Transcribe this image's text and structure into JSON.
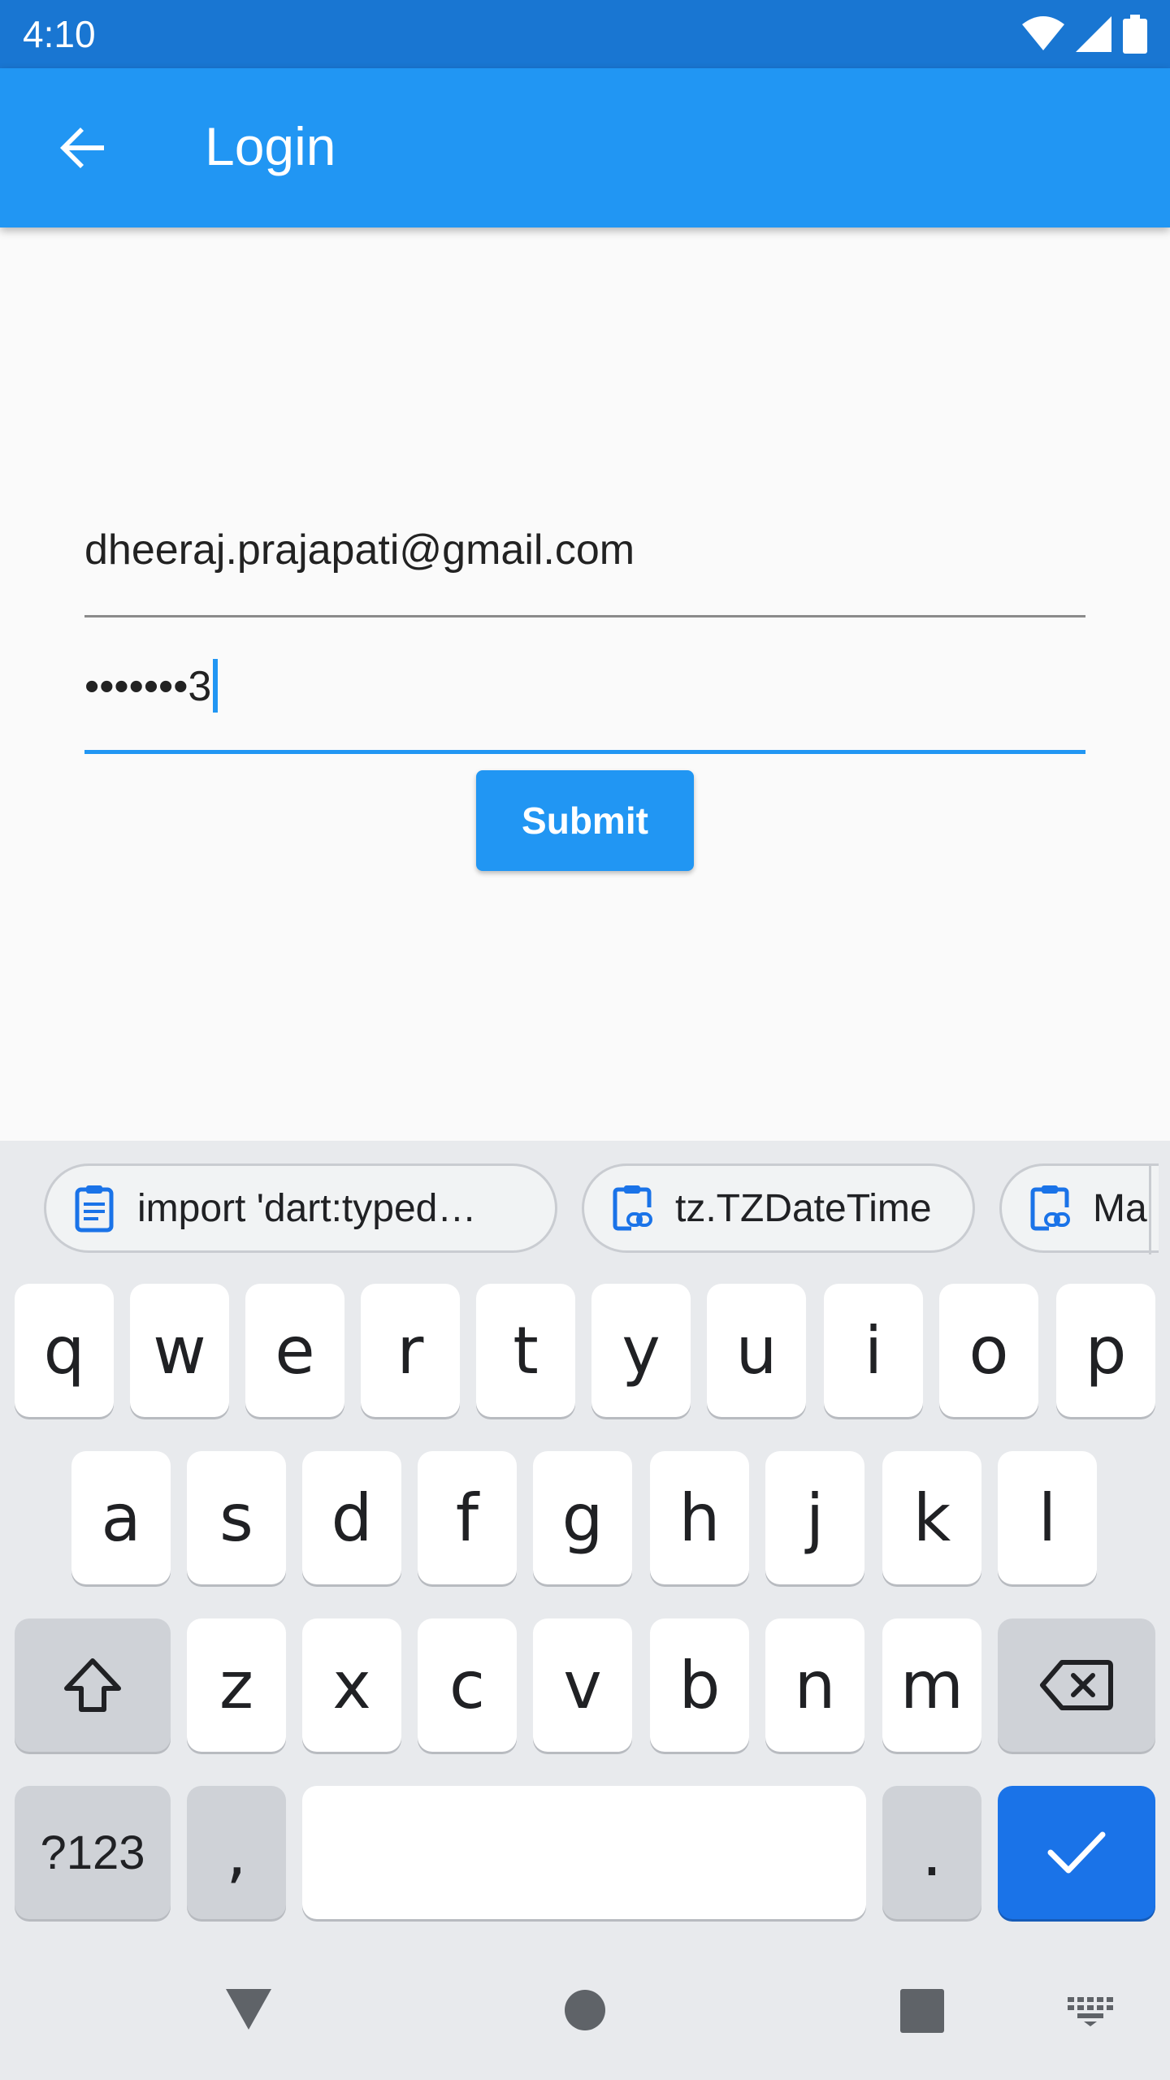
{
  "status_bar": {
    "time": "4:10"
  },
  "app_bar": {
    "title": "Login"
  },
  "form": {
    "email_value": "dheeraj.prajapati@gmail.com",
    "password_value": "•••••••3",
    "submit_label": "Submit"
  },
  "keyboard": {
    "clipboard_chips": [
      {
        "label": "import 'dart:typed…"
      },
      {
        "label": "tz.TZDateTime"
      },
      {
        "label": "Ma"
      }
    ],
    "row1": [
      "q",
      "w",
      "e",
      "r",
      "t",
      "y",
      "u",
      "i",
      "o",
      "p"
    ],
    "row2": [
      "a",
      "s",
      "d",
      "f",
      "g",
      "h",
      "j",
      "k",
      "l"
    ],
    "row3": [
      "z",
      "x",
      "c",
      "v",
      "b",
      "n",
      "m"
    ],
    "symbols_label": "?123",
    "comma_label": ",",
    "period_label": "."
  },
  "colors": {
    "status_bar": "#1976d2",
    "app_bar": "#2196f3",
    "accent": "#2196f3",
    "keyboard_action": "#1a73e8"
  }
}
